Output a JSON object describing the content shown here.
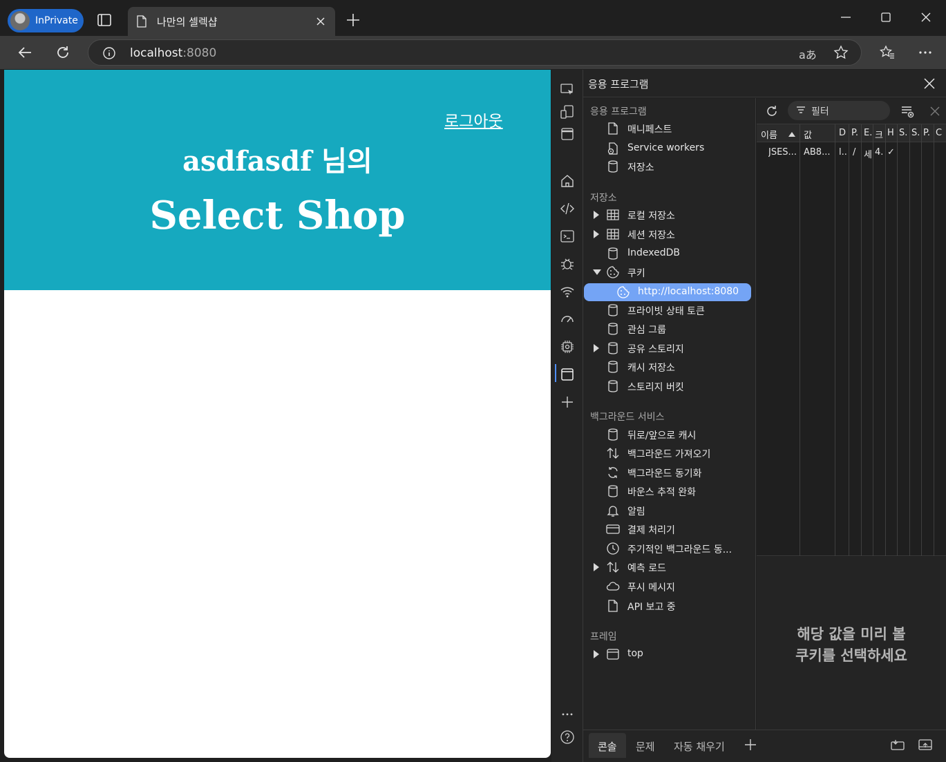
{
  "browser": {
    "profile_label": "InPrivate",
    "tab_title": "나만의 셀렉샵",
    "url_host": "localhost",
    "url_port": ":8080",
    "read_aloud_label": "aあ"
  },
  "page": {
    "logout_link": "로그아웃",
    "greeting": "asdfasdf 님의",
    "shop_title": "Select Shop"
  },
  "devtools": {
    "panel_title": "응용 프로그램",
    "sections": {
      "app": "응용 프로그램",
      "storage": "저장소",
      "background": "백그라운드 서비스",
      "frames": "프레임"
    },
    "app_items": [
      "매니페스트",
      "Service workers",
      "저장소"
    ],
    "storage_items": [
      "로컬 저장소",
      "세션 저장소",
      "IndexedDB",
      "쿠키",
      "http://localhost:8080",
      "프라이빗 상태 토큰",
      "관심 그룹",
      "공유 스토리지",
      "캐시 저장소",
      "스토리지 버킷"
    ],
    "background_items": [
      "뒤로/앞으로 캐시",
      "백그라운드 가져오기",
      "백그라운드 동기화",
      "바운스 추적 완화",
      "알림",
      "결제 처리기",
      "주기적인 백그라운드 동...",
      "예측 로드",
      "푸시 메시지",
      "API 보고 중"
    ],
    "frame_items": [
      "top"
    ],
    "filter_placeholder": "필터",
    "columns": [
      "이름",
      "값",
      "D",
      "P.",
      "E.",
      "크",
      "H",
      "S.",
      "S.",
      "P.",
      "C"
    ],
    "cookie_row": [
      "JSES...",
      "AB8...",
      "l..",
      "/",
      "세",
      "4.",
      "✓"
    ],
    "preview_line1": "해당 값을 미리 볼",
    "preview_line2": "쿠키를 선택하세요",
    "drawer_tabs": [
      "콘솔",
      "문제",
      "자동 채우기"
    ]
  }
}
